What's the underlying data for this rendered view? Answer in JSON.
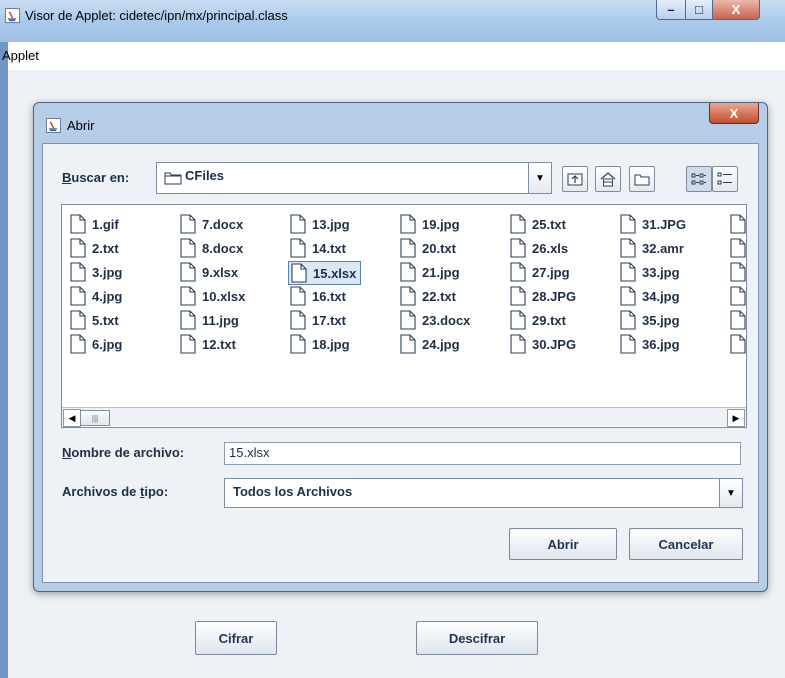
{
  "window": {
    "title": "Visor de Applet: cidetec/ipn/mx/principal.class",
    "controls": {
      "minimize": "–",
      "maximize": "□",
      "close": "X"
    }
  },
  "menubar": {
    "items": [
      "Applet"
    ]
  },
  "applet": {
    "buttons": {
      "encrypt": "Cifrar",
      "decrypt": "Descifrar"
    }
  },
  "dialog": {
    "title": "Abrir",
    "close": "X",
    "look_in": {
      "label_key": "B",
      "label_rest": "uscar en:",
      "value": "CFiles"
    },
    "toolbar_icons": [
      "up-folder-icon",
      "home-icon",
      "new-folder-icon",
      "list-view-icon",
      "details-view-icon"
    ],
    "files": [
      [
        "1.gif",
        "2.txt",
        "3.jpg",
        "4.jpg",
        "5.txt",
        "6.jpg"
      ],
      [
        "7.docx",
        "8.docx",
        "9.xlsx",
        "10.xlsx",
        "11.jpg",
        "12.txt"
      ],
      [
        "13.jpg",
        "14.txt",
        "15.xlsx",
        "16.txt",
        "17.txt",
        "18.jpg"
      ],
      [
        "19.jpg",
        "20.txt",
        "21.jpg",
        "22.txt",
        "23.docx",
        "24.jpg"
      ],
      [
        "25.txt",
        "26.xls",
        "27.jpg",
        "28.JPG",
        "29.txt",
        "30.JPG"
      ],
      [
        "31.JPG",
        "32.amr",
        "33.jpg",
        "34.jpg",
        "35.jpg",
        "36.jpg"
      ]
    ],
    "selected_file": "15.xlsx",
    "file_name": {
      "label_key": "N",
      "label_rest": "ombre de archivo:",
      "value": "15.xlsx"
    },
    "file_type": {
      "label_before": "Archivos de ",
      "label_key": "t",
      "label_after": "ipo:",
      "value": "Todos los Archivos"
    },
    "buttons": {
      "open": "Abrir",
      "cancel": "Cancelar"
    }
  }
}
